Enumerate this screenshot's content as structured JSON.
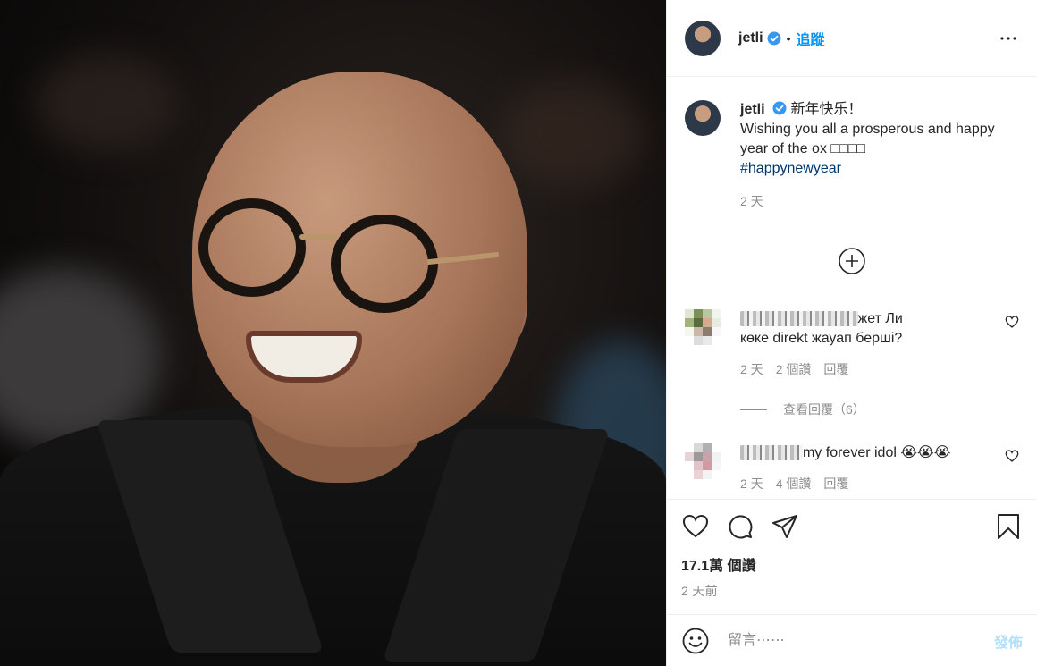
{
  "header": {
    "username": "jetli",
    "separator": "•",
    "follow_label": "追蹤"
  },
  "caption": {
    "username": "jetli",
    "line1": "新年快乐！",
    "line2": "Wishing you all a prosperous and happy year of the ox",
    "emoji_placeholder": "□□□□",
    "hashtag": "#happynewyear",
    "time": "2 天"
  },
  "comments": [
    {
      "blurred_name": "▆▆ ▆▆▁▁▁▁▁▁",
      "text_suffix": "жет Ли",
      "text_line2": "көке direkt жауап берші?",
      "time": "2 天",
      "likes": "2 個讚",
      "reply_label": "回覆"
    },
    {
      "blurred_name": "▆▆▆ ▆▆",
      "text_suffix": "my forever idol 😭😭😭",
      "time": "2 天",
      "likes": "4 個讚",
      "reply_label": "回覆"
    }
  ],
  "view_replies": "查看回覆（6）",
  "likes_count": "17.1萬 個讚",
  "post_time": "2 天前",
  "add_comment": {
    "placeholder": "留言⋯⋯",
    "post_label": "發佈"
  },
  "colors": {
    "accent": "#0095f6",
    "hashtag": "#00376b",
    "muted": "#8e8e8e",
    "post_disabled": "#b2dffc"
  }
}
